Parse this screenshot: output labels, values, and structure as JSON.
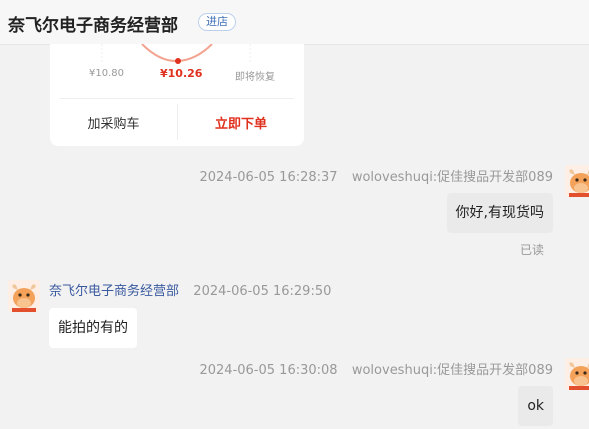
{
  "header": {
    "shop_name": "奈飞尔电子商务经营部",
    "enter_shop_label": "进店"
  },
  "product_card": {
    "price_past": "¥10.80",
    "price_current": "¥10.26",
    "price_future": "即将恢复",
    "add_to_cart_label": "加采购车",
    "order_now_label": "立即下单",
    "accent_color": "#e0301e"
  },
  "messages": [
    {
      "direction": "outgoing",
      "time": "2024-06-05 16:28:37",
      "sender": "woloveshuqi:促佳搜品开发部089",
      "text": "你好,有现货吗",
      "status": "已读"
    },
    {
      "direction": "incoming",
      "sender": "奈飞尔电子商务经营部",
      "time": "2024-06-05 16:29:50",
      "text": "能拍的有的"
    },
    {
      "direction": "outgoing",
      "time": "2024-06-05 16:30:08",
      "sender": "woloveshuqi:促佳搜品开发部089",
      "text": "ok"
    }
  ],
  "icons": {
    "avatar": "cartoon-bull-avatar-icon"
  }
}
